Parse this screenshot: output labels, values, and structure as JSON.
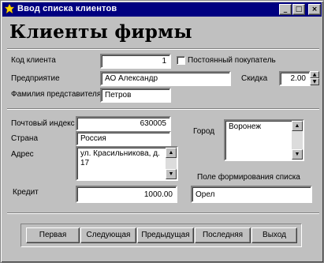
{
  "window": {
    "title": "Ввод списка клиентов",
    "minimize_glyph": "_",
    "maximize_glyph": "□",
    "close_glyph": "×"
  },
  "heading": "Клиенты фирмы",
  "form": {
    "client_code": {
      "label": "Код клиента",
      "value": "1"
    },
    "regular_customer": {
      "label": "Постоянный покупатель",
      "checked": false
    },
    "enterprise": {
      "label": "Предприятие",
      "value": "АО Александр"
    },
    "discount": {
      "label": "Скидка",
      "value": "2.00"
    },
    "representative": {
      "label": "Фамилия представителя",
      "value": "Петров"
    },
    "postal_code": {
      "label": "Почтовый индекс",
      "value": "630005"
    },
    "country": {
      "label": "Страна",
      "value": "Россия"
    },
    "address": {
      "label": "Адрес",
      "value": "ул. Красильникова, д. 17"
    },
    "city": {
      "label": "Город",
      "value": "Воронеж"
    },
    "list_field": {
      "label": "Поле формирования списка",
      "value": "Орел"
    },
    "credit": {
      "label": "Кредит",
      "value": "1000.00"
    }
  },
  "navigation": {
    "first": "Первая",
    "next": "Следующая",
    "previous": "Предыдущая",
    "last": "Последняя",
    "exit": "Выход"
  }
}
